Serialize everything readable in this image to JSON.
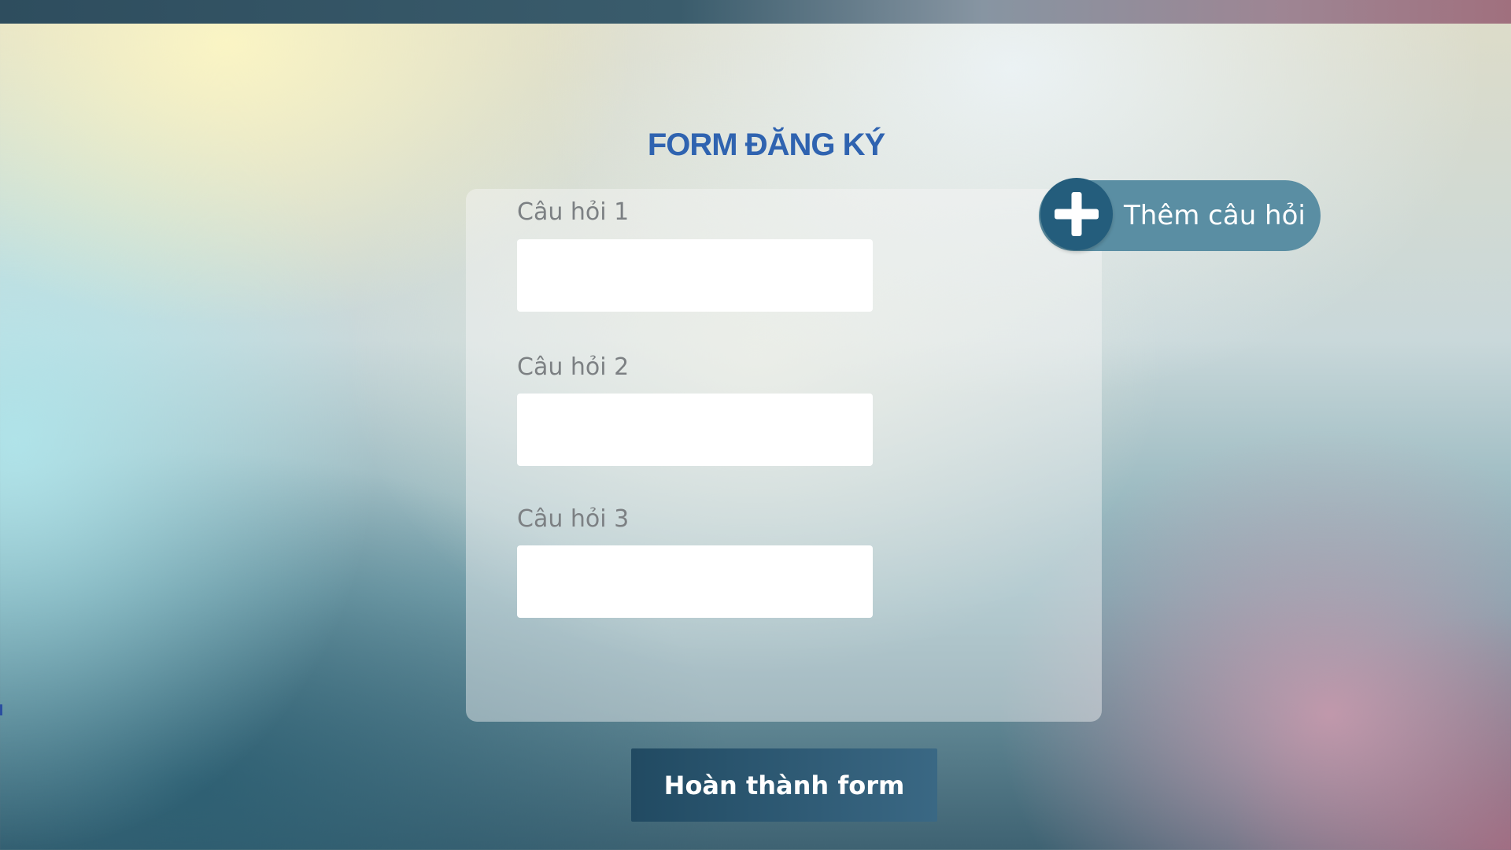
{
  "form": {
    "title": "FORM ĐĂNG KÝ",
    "questions": [
      {
        "label": "Câu hỏi 1",
        "value": "",
        "placeholder": ""
      },
      {
        "label": "Câu hỏi 2",
        "value": "",
        "placeholder": ""
      },
      {
        "label": "Câu hỏi 3",
        "value": "",
        "placeholder": ""
      }
    ],
    "add_question_label": "Thêm câu hỏi",
    "add_question_icon": "plus-icon",
    "submit_label": "Hoàn thành form"
  },
  "colors": {
    "title": "#2f63b0",
    "add_button": "#5a8ea3",
    "add_icon_circle": "#245d7c",
    "submit_button": "#2c5672",
    "top_bar": "#2e4d5e"
  }
}
